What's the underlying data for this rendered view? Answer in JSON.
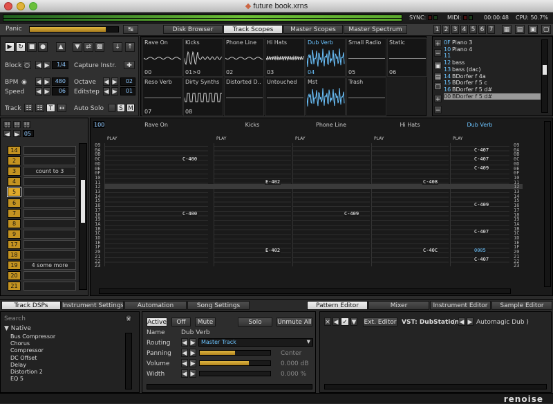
{
  "window": {
    "title": "future book.xrns"
  },
  "topbar": {
    "sync": "SYNC:",
    "midi": "MIDI:",
    "time": "00:00:48",
    "cpu": "CPU: 50.7%"
  },
  "panic": "Panic",
  "tabs": {
    "disk_browser": "Disk Browser",
    "track_scopes": "Track Scopes",
    "master_scopes": "Master Scopes",
    "master_spectrum": "Master Spectrum",
    "active": "Track Scopes"
  },
  "layouts": [
    "1",
    "2",
    "3",
    "4",
    "5",
    "6",
    "7"
  ],
  "transport": {
    "block_label": "Block",
    "block_value": "1/4",
    "capture_label": "Capture Instr.",
    "bpm_label": "BPM",
    "bpm_value": "480",
    "octave_label": "Octave",
    "octave_value": "02",
    "speed_label": "Speed",
    "speed_value": "06",
    "editstep_label": "Editstep",
    "editstep_value": "01",
    "track_label": "Track",
    "autosolo_label": "Auto Solo"
  },
  "scopes": [
    {
      "name": "Rave On",
      "num": "00"
    },
    {
      "name": "Kicks",
      "num": "01>0"
    },
    {
      "name": "Phone Line",
      "num": "02"
    },
    {
      "name": "Hi Hats",
      "num": "03"
    },
    {
      "name": "Dub Verb",
      "num": "04",
      "active": true
    },
    {
      "name": "Small Radio",
      "num": "05"
    },
    {
      "name": "Static",
      "num": "06"
    },
    {
      "name": "Reso Verb",
      "num": "07"
    },
    {
      "name": "Dirty Synths",
      "num": "08"
    },
    {
      "name": "Distorted D..",
      "num": ""
    },
    {
      "name": "Untouched",
      "num": ""
    },
    {
      "name": "Mst",
      "num": ""
    },
    {
      "name": "Trash",
      "num": ""
    }
  ],
  "instruments": [
    {
      "n": "0F",
      "name": "Piano 3"
    },
    {
      "n": "10",
      "name": "Piano 4"
    },
    {
      "n": "11",
      "name": ""
    },
    {
      "n": "12",
      "name": "bass"
    },
    {
      "n": "13",
      "name": "bass (dac)"
    },
    {
      "n": "14",
      "name": "BDorfer f  4a"
    },
    {
      "n": "15",
      "name": "BDorfer f  5 c"
    },
    {
      "n": "16",
      "name": "BDorfer f  5 d#"
    },
    {
      "n": "00",
      "name": "BDorfer f  5 d#",
      "selected": true
    }
  ],
  "sequencer": {
    "pattern_num": "05",
    "rows": [
      {
        "n": "14",
        "name": ""
      },
      {
        "n": "2",
        "name": ""
      },
      {
        "n": "3",
        "name": "count to 3"
      },
      {
        "n": "4",
        "name": ""
      },
      {
        "n": "5",
        "name": "",
        "current": true
      },
      {
        "n": "6",
        "name": ""
      },
      {
        "n": "7",
        "name": ""
      },
      {
        "n": "8",
        "name": ""
      },
      {
        "n": "9",
        "name": ""
      },
      {
        "n": "17",
        "name": ""
      },
      {
        "n": "18",
        "name": ""
      },
      {
        "n": "19",
        "name": "4 some more"
      },
      {
        "n": "20",
        "name": ""
      },
      {
        "n": "21",
        "name": ""
      }
    ]
  },
  "pattern": {
    "lines": "100",
    "tracks": [
      "Rave On",
      "Kicks",
      "Phone Line",
      "Hi Hats",
      "Dub Verb"
    ],
    "active_track": "Dub Verb",
    "play_label": "PLAY",
    "row_numbers": [
      "09",
      "0A",
      "0B",
      "0C",
      "0D",
      "0E",
      "0F",
      "10",
      "11",
      "12",
      "13",
      "14",
      "15",
      "16",
      "17",
      "18",
      "19",
      "1A",
      "1B",
      "1C",
      "1D",
      "1E",
      "1F",
      "20",
      "21",
      "22",
      "23"
    ],
    "right_numbers": [
      "09",
      "0A",
      "0B",
      "0C",
      "0D",
      "0E",
      "0F",
      "10",
      "11",
      "12",
      "13",
      "14",
      "15",
      "16",
      "17",
      "18",
      "19",
      "1A",
      "1B",
      "1C",
      "1D",
      "1E",
      "1F",
      "20",
      "21",
      "22",
      "23"
    ],
    "notes": [
      {
        "t": "C-400",
        "track": 0,
        "row": 3
      },
      {
        "t": "E-402",
        "track": 1,
        "row": 8
      },
      {
        "t": "C-408",
        "track": 3,
        "row": 8
      },
      {
        "t": "C-400",
        "track": 0,
        "row": 15
      },
      {
        "t": "C-409",
        "track": 2,
        "row": 15
      },
      {
        "t": "E-402",
        "track": 1,
        "row": 23
      },
      {
        "t": "C-40C",
        "track": 3,
        "row": 23
      },
      {
        "t": "0005",
        "track": 4,
        "row": 23,
        "active": true
      },
      {
        "t": "C-407",
        "track": 4,
        "row": 1
      },
      {
        "t": "C-407",
        "track": 4,
        "row": 3
      },
      {
        "t": "C-409",
        "track": 4,
        "row": 5
      },
      {
        "t": "C-409",
        "track": 4,
        "row": 13
      },
      {
        "t": "C-407",
        "track": 4,
        "row": 19
      },
      {
        "t": "C-407",
        "track": 4,
        "row": 25
      }
    ]
  },
  "bottom_tabs_left": [
    "Track DSPs",
    "Instrument Settings",
    "Automation",
    "Song Settings"
  ],
  "bottom_tabs_right": [
    "Pattern Editor",
    "Mixer",
    "Instrument Editor",
    "Sample Editor"
  ],
  "dsp": {
    "search": "Search",
    "group": "Native",
    "items": [
      "Bus Compressor",
      "Chorus",
      "Compressor",
      "DC Offset",
      "Delay",
      "Distortion 2",
      "EQ 5"
    ]
  },
  "mixer": {
    "active": "Active",
    "off": "Off",
    "mute": "Mute",
    "solo": "Solo",
    "unmute_all": "Unmute All",
    "name_label": "Name",
    "name_value": "Dub Verb",
    "routing_label": "Routing",
    "routing_value": "Master Track",
    "panning_label": "Panning",
    "panning_value": "Center",
    "panning_level": 0.5,
    "volume_label": "Volume",
    "volume_value": "0.000 dB",
    "volume_level": 0.7,
    "width_label": "Width",
    "width_value": "0.000 %",
    "width_level": 0.0
  },
  "fx": {
    "ext_editor": "Ext. Editor",
    "vst": "VST: DubStation",
    "automagic": "Automagic Dub )"
  },
  "logo": "renoise",
  "colors": {
    "accent": "#6cc4ff",
    "sequence": "#c49321",
    "meter": "#6cbf35"
  }
}
